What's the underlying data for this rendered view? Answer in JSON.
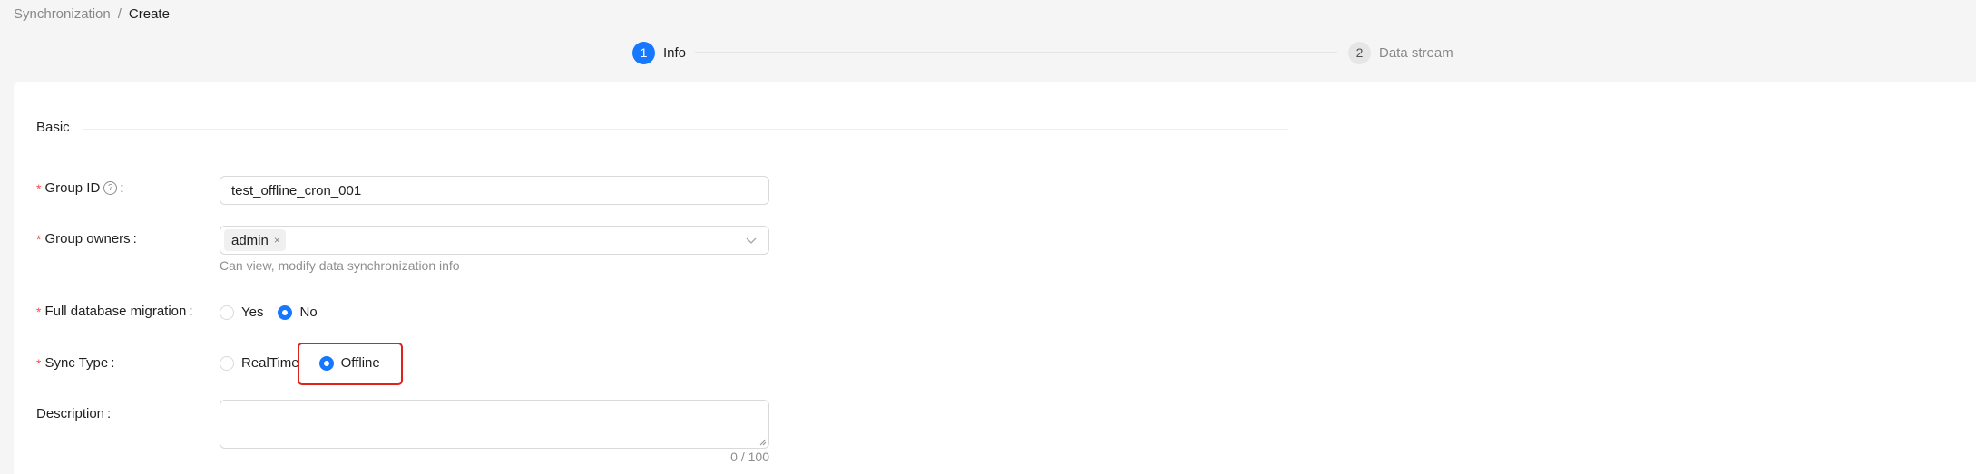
{
  "breadcrumb": {
    "parent": "Synchronization",
    "separator": "/",
    "current": "Create"
  },
  "steps": [
    {
      "number": "1",
      "title": "Info",
      "status": "active"
    },
    {
      "number": "2",
      "title": "Data stream",
      "status": "wait"
    }
  ],
  "section": {
    "title": "Basic"
  },
  "form": {
    "group_id": {
      "label": "Group ID",
      "value": "test_offline_cron_001"
    },
    "group_owners": {
      "label": "Group owners",
      "tags": [
        "admin"
      ],
      "help": "Can view, modify data synchronization info"
    },
    "full_db_migration": {
      "label": "Full database migration",
      "options": [
        "Yes",
        "No"
      ],
      "selected": "No"
    },
    "sync_type": {
      "label": "Sync Type",
      "options": [
        "RealTime",
        "Offline"
      ],
      "selected": "Offline"
    },
    "description": {
      "label": "Description",
      "value": "",
      "counter": "0 / 100"
    }
  },
  "colors": {
    "primary": "#1677ff",
    "required": "#ff4d4f",
    "highlight": "#e0231a"
  },
  "symbols": {
    "required": "*",
    "colon": ":",
    "help": "?",
    "tag_close": "×"
  }
}
